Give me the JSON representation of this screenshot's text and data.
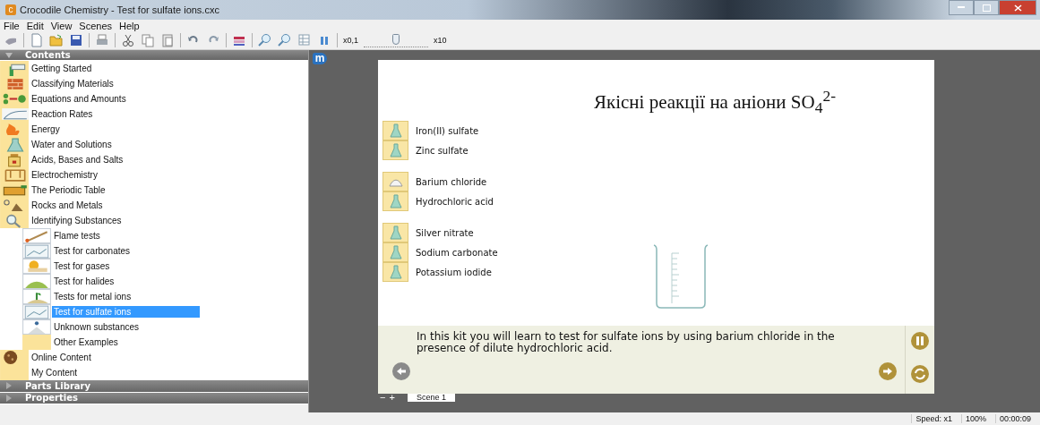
{
  "window": {
    "app_icon_letter": "c",
    "title": "Crocodile Chemistry - Test for sulfate ions.cxc"
  },
  "menu": [
    "File",
    "Edit",
    "View",
    "Scenes",
    "Help"
  ],
  "toolbar": {
    "speed_slider": {
      "min_label": "x0,1",
      "max_label": "x10",
      "level": 0.5
    }
  },
  "contents": {
    "title": "Contents",
    "items": [
      {
        "label": "Getting Started",
        "selected": false
      },
      {
        "label": "Classifying Materials",
        "selected": false
      },
      {
        "label": "Equations and Amounts",
        "selected": false
      },
      {
        "label": "Reaction Rates",
        "selected": false
      },
      {
        "label": "Energy",
        "selected": false
      },
      {
        "label": "Water and Solutions",
        "selected": false
      },
      {
        "label": "Acids, Bases and Salts",
        "selected": false
      },
      {
        "label": "Electrochemistry",
        "selected": false
      },
      {
        "label": "The Periodic Table",
        "selected": false
      },
      {
        "label": "Rocks and Metals",
        "selected": false
      },
      {
        "label": "Identifying Substances",
        "selected": false,
        "children": [
          {
            "label": "Flame tests",
            "selected": false
          },
          {
            "label": "Test for carbonates",
            "selected": false
          },
          {
            "label": "Test for gases",
            "selected": false
          },
          {
            "label": "Test for halides",
            "selected": false
          },
          {
            "label": "Tests for metal ions",
            "selected": false
          },
          {
            "label": "Test for sulfate ions",
            "selected": true
          },
          {
            "label": "Unknown substances",
            "selected": false
          },
          {
            "label": "Other Examples",
            "selected": false
          }
        ]
      },
      {
        "label": "Online Content",
        "selected": false
      },
      {
        "label": "My Content",
        "selected": false
      }
    ]
  },
  "collapsed_panels": [
    "Parts Library",
    "Properties"
  ],
  "logo": "m",
  "slide": {
    "title": "Якісні реакції на аніони SO$_{4}$$^{2-}$",
    "reagent_groups": [
      [
        {
          "name": "Iron(II) sulfate",
          "kind": "solution"
        },
        {
          "name": "Zinc sulfate",
          "kind": "solution"
        }
      ],
      [
        {
          "name": "Barium chloride",
          "kind": "powder"
        },
        {
          "name": "Hydrochloric acid",
          "kind": "solution"
        }
      ],
      [
        {
          "name": "Silver nitrate",
          "kind": "solution"
        },
        {
          "name": "Sodium carbonate",
          "kind": "solution"
        },
        {
          "name": "Potassium iodide",
          "kind": "solution"
        }
      ]
    ],
    "caption": "In this kit you will learn to test for sulfate ions by using barium chloride in the presence of dilute hydrochloric acid."
  },
  "scenes": {
    "controls": [
      "−",
      "+"
    ],
    "tabs": [
      {
        "label": "Scene 1",
        "selected": true
      }
    ]
  },
  "status_bar": {
    "speed": "Speed: x1",
    "zoom": "100%",
    "time": "00:00:09"
  }
}
